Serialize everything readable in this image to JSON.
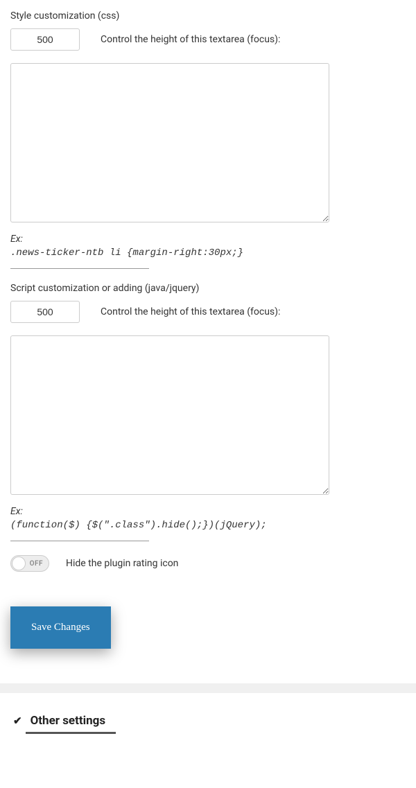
{
  "css_section": {
    "label": "Style customization (css)",
    "height_value": "500",
    "height_hint": "Control the height of this textarea (focus):",
    "textarea_value": "",
    "example_label": "Ex:",
    "example_code": ".news-ticker-ntb li {margin-right:30px;}"
  },
  "script_section": {
    "label": "Script customization or adding (java/jquery)",
    "height_value": "500",
    "height_hint": "Control the height of this textarea (focus):",
    "textarea_value": "",
    "example_label": "Ex:",
    "example_code": "(function($) {$(\".class\").hide();})(jQuery);"
  },
  "rating_toggle": {
    "state": "OFF",
    "label": "Hide the plugin rating icon"
  },
  "save_button": "Save Changes",
  "other_section": {
    "title": "Other settings"
  }
}
